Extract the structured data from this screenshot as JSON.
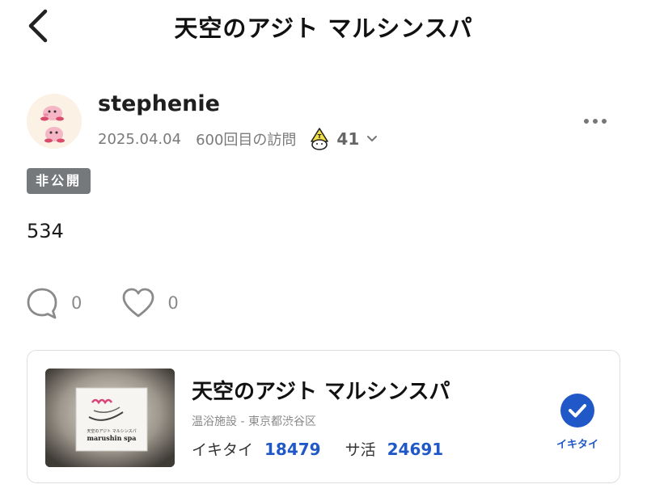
{
  "header": {
    "title": "天空のアジト マルシンスパ",
    "back_icon": "chevron-left-icon"
  },
  "post": {
    "username": "stephenie",
    "date": "2025.04.04",
    "visit_label": "600回目の訪問",
    "sauna_count": "41",
    "badge": "非公開",
    "body": "534",
    "comment_count": "0",
    "like_count": "0"
  },
  "facility": {
    "name": "天空のアジト マルシンスパ",
    "category": "温浴施設 - 東京都渋谷区",
    "ikitai_label": "イキタイ",
    "ikitai_count": "18479",
    "sakatsu_label": "サ活",
    "sakatsu_count": "24691",
    "ikitai_button_label": "イキタイ",
    "image_sign_small": "天空のアジト マルシンスパ",
    "image_sign_large": "marushin spa"
  },
  "colors": {
    "accent": "#2158c8",
    "badge_bg": "#75797c",
    "muted_text": "#7a7a7a"
  }
}
